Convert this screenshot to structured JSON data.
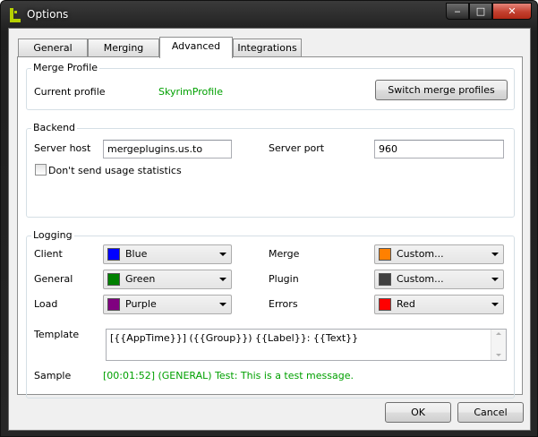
{
  "window": {
    "title": "Options",
    "minimize_glyph": "‒",
    "maximize_glyph": "□",
    "close_glyph": "✕"
  },
  "tabs": [
    "General",
    "Merging",
    "Advanced",
    "Integrations"
  ],
  "active_tab": "Advanced",
  "merge_profile": {
    "group_label": "Merge Profile",
    "current_label": "Current profile",
    "current_value": "SkyrimProfile",
    "switch_button": "Switch merge profiles"
  },
  "backend": {
    "group_label": "Backend",
    "host_label": "Server host",
    "host_value": "mergeplugins.us.to",
    "port_label": "Server port",
    "port_value": "960",
    "usage_label": "Don't send usage statistics"
  },
  "logging": {
    "group_label": "Logging",
    "client": {
      "label": "Client",
      "value": "Blue",
      "color": "#0000ff"
    },
    "general": {
      "label": "General",
      "value": "Green",
      "color": "#008000"
    },
    "load": {
      "label": "Load",
      "value": "Purple",
      "color": "#800080"
    },
    "merge": {
      "label": "Merge",
      "value": "Custom...",
      "color": "#ff8000"
    },
    "plugin": {
      "label": "Plugin",
      "value": "Custom...",
      "color": "#404040"
    },
    "errors": {
      "label": "Errors",
      "value": "Red",
      "color": "#ff0000"
    },
    "template_label": "Template",
    "template_value": "[{{AppTime}}] ({{Group}}) {{Label}}: {{Text}}",
    "sample_label": "Sample",
    "sample_value": "[00:01:52] (GENERAL) Test: This is a test message."
  },
  "footer": {
    "ok": "OK",
    "cancel": "Cancel"
  }
}
